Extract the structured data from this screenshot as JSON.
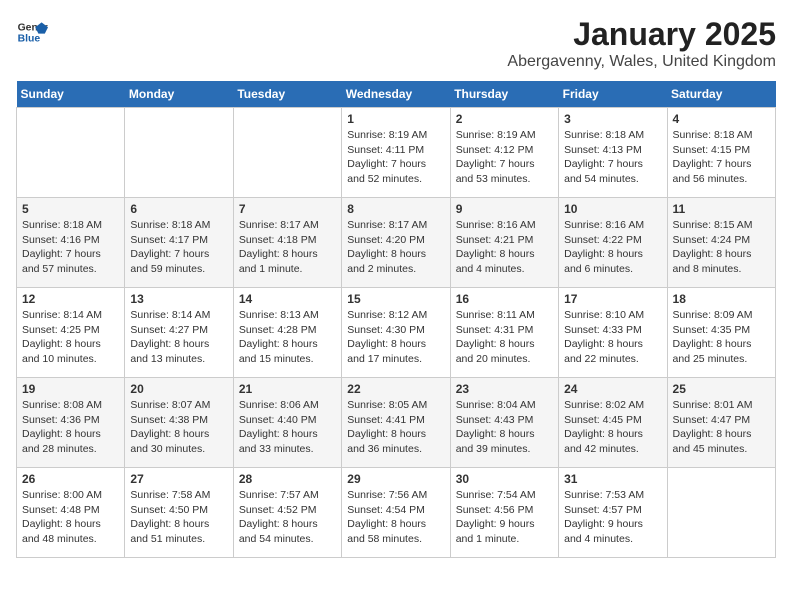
{
  "logo": {
    "line1": "General",
    "line2": "Blue"
  },
  "title": "January 2025",
  "subtitle": "Abergavenny, Wales, United Kingdom",
  "days_of_week": [
    "Sunday",
    "Monday",
    "Tuesday",
    "Wednesday",
    "Thursday",
    "Friday",
    "Saturday"
  ],
  "weeks": [
    [
      {
        "num": "",
        "info": ""
      },
      {
        "num": "",
        "info": ""
      },
      {
        "num": "",
        "info": ""
      },
      {
        "num": "1",
        "info": "Sunrise: 8:19 AM\nSunset: 4:11 PM\nDaylight: 7 hours\nand 52 minutes."
      },
      {
        "num": "2",
        "info": "Sunrise: 8:19 AM\nSunset: 4:12 PM\nDaylight: 7 hours\nand 53 minutes."
      },
      {
        "num": "3",
        "info": "Sunrise: 8:18 AM\nSunset: 4:13 PM\nDaylight: 7 hours\nand 54 minutes."
      },
      {
        "num": "4",
        "info": "Sunrise: 8:18 AM\nSunset: 4:15 PM\nDaylight: 7 hours\nand 56 minutes."
      }
    ],
    [
      {
        "num": "5",
        "info": "Sunrise: 8:18 AM\nSunset: 4:16 PM\nDaylight: 7 hours\nand 57 minutes."
      },
      {
        "num": "6",
        "info": "Sunrise: 8:18 AM\nSunset: 4:17 PM\nDaylight: 7 hours\nand 59 minutes."
      },
      {
        "num": "7",
        "info": "Sunrise: 8:17 AM\nSunset: 4:18 PM\nDaylight: 8 hours\nand 1 minute."
      },
      {
        "num": "8",
        "info": "Sunrise: 8:17 AM\nSunset: 4:20 PM\nDaylight: 8 hours\nand 2 minutes."
      },
      {
        "num": "9",
        "info": "Sunrise: 8:16 AM\nSunset: 4:21 PM\nDaylight: 8 hours\nand 4 minutes."
      },
      {
        "num": "10",
        "info": "Sunrise: 8:16 AM\nSunset: 4:22 PM\nDaylight: 8 hours\nand 6 minutes."
      },
      {
        "num": "11",
        "info": "Sunrise: 8:15 AM\nSunset: 4:24 PM\nDaylight: 8 hours\nand 8 minutes."
      }
    ],
    [
      {
        "num": "12",
        "info": "Sunrise: 8:14 AM\nSunset: 4:25 PM\nDaylight: 8 hours\nand 10 minutes."
      },
      {
        "num": "13",
        "info": "Sunrise: 8:14 AM\nSunset: 4:27 PM\nDaylight: 8 hours\nand 13 minutes."
      },
      {
        "num": "14",
        "info": "Sunrise: 8:13 AM\nSunset: 4:28 PM\nDaylight: 8 hours\nand 15 minutes."
      },
      {
        "num": "15",
        "info": "Sunrise: 8:12 AM\nSunset: 4:30 PM\nDaylight: 8 hours\nand 17 minutes."
      },
      {
        "num": "16",
        "info": "Sunrise: 8:11 AM\nSunset: 4:31 PM\nDaylight: 8 hours\nand 20 minutes."
      },
      {
        "num": "17",
        "info": "Sunrise: 8:10 AM\nSunset: 4:33 PM\nDaylight: 8 hours\nand 22 minutes."
      },
      {
        "num": "18",
        "info": "Sunrise: 8:09 AM\nSunset: 4:35 PM\nDaylight: 8 hours\nand 25 minutes."
      }
    ],
    [
      {
        "num": "19",
        "info": "Sunrise: 8:08 AM\nSunset: 4:36 PM\nDaylight: 8 hours\nand 28 minutes."
      },
      {
        "num": "20",
        "info": "Sunrise: 8:07 AM\nSunset: 4:38 PM\nDaylight: 8 hours\nand 30 minutes."
      },
      {
        "num": "21",
        "info": "Sunrise: 8:06 AM\nSunset: 4:40 PM\nDaylight: 8 hours\nand 33 minutes."
      },
      {
        "num": "22",
        "info": "Sunrise: 8:05 AM\nSunset: 4:41 PM\nDaylight: 8 hours\nand 36 minutes."
      },
      {
        "num": "23",
        "info": "Sunrise: 8:04 AM\nSunset: 4:43 PM\nDaylight: 8 hours\nand 39 minutes."
      },
      {
        "num": "24",
        "info": "Sunrise: 8:02 AM\nSunset: 4:45 PM\nDaylight: 8 hours\nand 42 minutes."
      },
      {
        "num": "25",
        "info": "Sunrise: 8:01 AM\nSunset: 4:47 PM\nDaylight: 8 hours\nand 45 minutes."
      }
    ],
    [
      {
        "num": "26",
        "info": "Sunrise: 8:00 AM\nSunset: 4:48 PM\nDaylight: 8 hours\nand 48 minutes."
      },
      {
        "num": "27",
        "info": "Sunrise: 7:58 AM\nSunset: 4:50 PM\nDaylight: 8 hours\nand 51 minutes."
      },
      {
        "num": "28",
        "info": "Sunrise: 7:57 AM\nSunset: 4:52 PM\nDaylight: 8 hours\nand 54 minutes."
      },
      {
        "num": "29",
        "info": "Sunrise: 7:56 AM\nSunset: 4:54 PM\nDaylight: 8 hours\nand 58 minutes."
      },
      {
        "num": "30",
        "info": "Sunrise: 7:54 AM\nSunset: 4:56 PM\nDaylight: 9 hours\nand 1 minute."
      },
      {
        "num": "31",
        "info": "Sunrise: 7:53 AM\nSunset: 4:57 PM\nDaylight: 9 hours\nand 4 minutes."
      },
      {
        "num": "",
        "info": ""
      }
    ]
  ]
}
